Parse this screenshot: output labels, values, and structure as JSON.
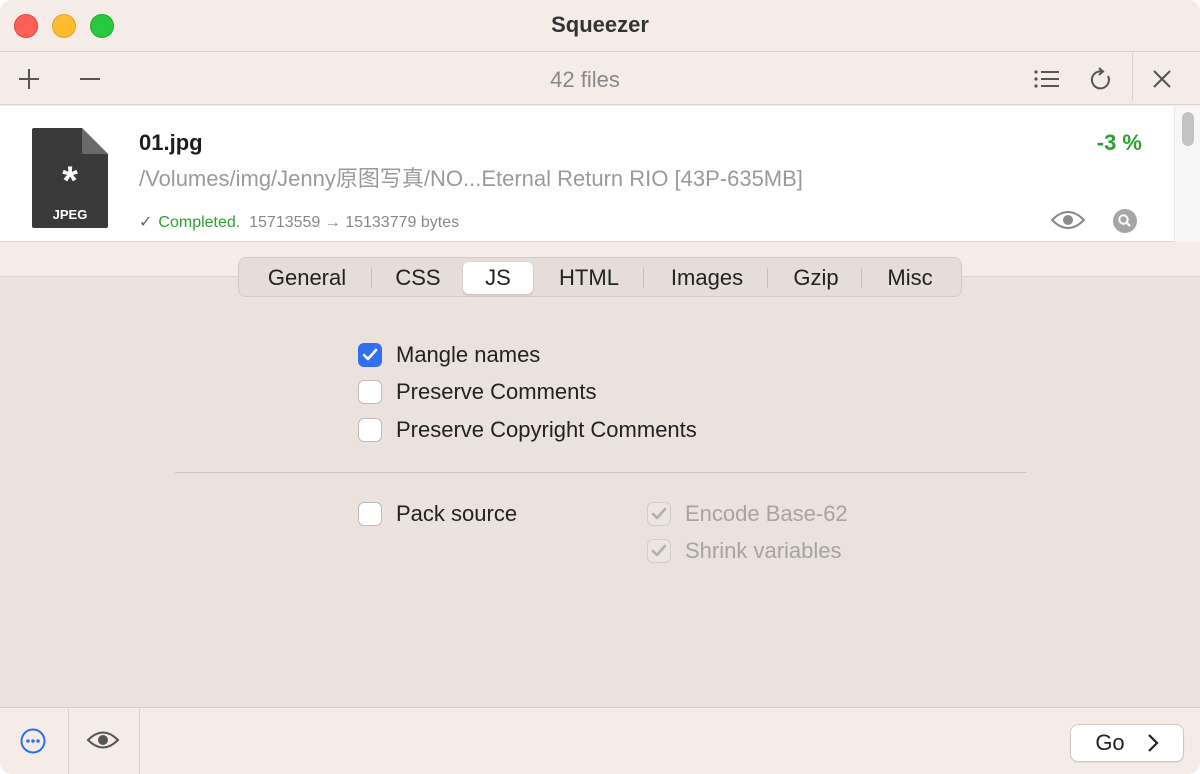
{
  "app": {
    "title": "Squeezer"
  },
  "toolbar": {
    "file_count": "42 files",
    "icons": [
      "plus-icon",
      "minus-icon",
      "list-icon",
      "refresh-icon",
      "close-icon"
    ]
  },
  "file": {
    "name": "01.jpg",
    "path": "/Volumes/img/Jenny原图写真/NO...Eternal Return RIO [43P-635MB]",
    "percent": "-3 %",
    "icon_label": "JPEG",
    "icon_symbol": "*",
    "status_check": "✓",
    "status": "Completed.",
    "bytes": "15713559 → 15133779 bytes"
  },
  "tabs": [
    {
      "label": "General",
      "active": false
    },
    {
      "label": "CSS",
      "active": false
    },
    {
      "label": "JS",
      "active": true
    },
    {
      "label": "HTML",
      "active": false
    },
    {
      "label": "Images",
      "active": false
    },
    {
      "label": "Gzip",
      "active": false
    },
    {
      "label": "Misc",
      "active": false
    }
  ],
  "options": {
    "mangle": {
      "label": "Mangle names",
      "checked": true
    },
    "preserve_comments": {
      "label": "Preserve Comments",
      "checked": false
    },
    "preserve_copyright": {
      "label": "Preserve Copyright Comments",
      "checked": false
    },
    "pack_source": {
      "label": "Pack source",
      "checked": false
    },
    "encode_base62": {
      "label": "Encode Base-62",
      "checked": true,
      "enabled": false
    },
    "shrink_variables": {
      "label": "Shrink variables",
      "checked": true,
      "enabled": false
    }
  },
  "bottom": {
    "go_label": "Go"
  },
  "colors": {
    "accent": "#2f6ff0",
    "success": "#2aa12f",
    "window_bg": "#f5ece8"
  }
}
